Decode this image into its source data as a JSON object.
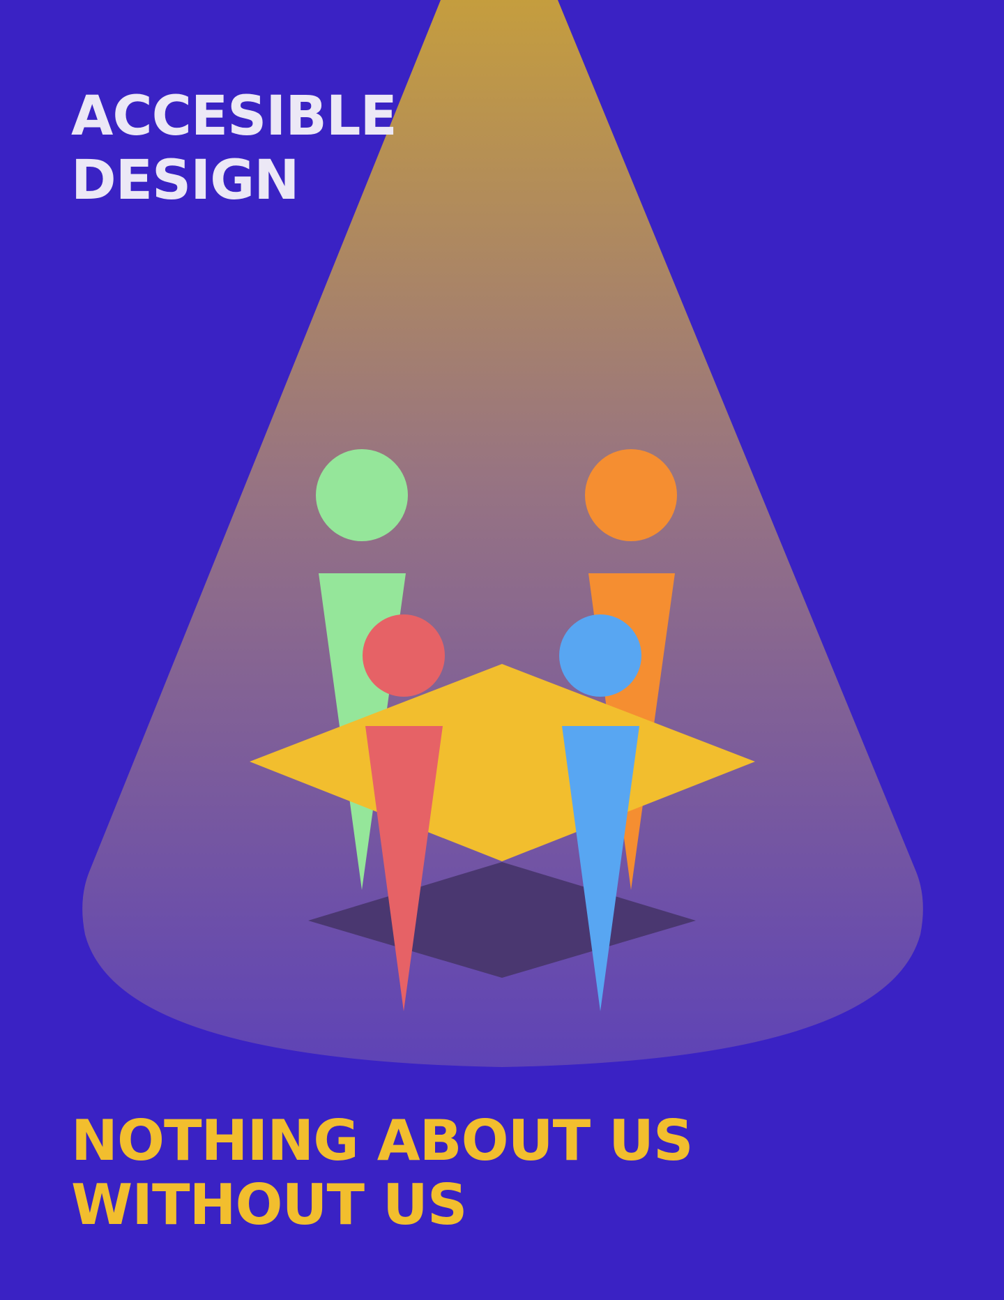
{
  "headline": {
    "line1": "ACCESIBLE",
    "line2": "DESIGN"
  },
  "tagline": {
    "line1": "NOTHING ABOUT US",
    "line2": "WITHOUT US"
  },
  "colors": {
    "background": "#3a22c4",
    "spotlight_top": "#c9a13a",
    "spotlight_bottom": "#5f44b6",
    "headline_text": "#ece8f6",
    "tagline_text": "#f2be2e",
    "table_top": "#f2be2e",
    "table_shadow": "#4a3770",
    "figure_green": "#95e69a",
    "figure_orange": "#f58e31",
    "figure_red": "#e66266",
    "figure_blue": "#58a6f2"
  }
}
